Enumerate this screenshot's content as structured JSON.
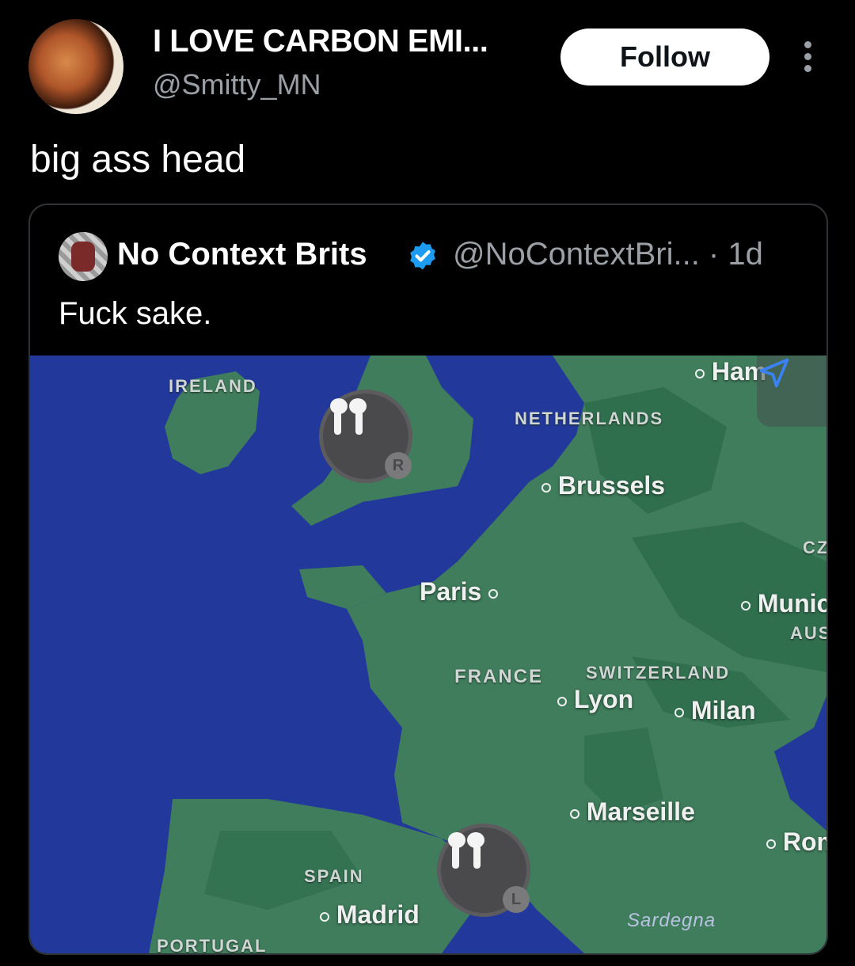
{
  "author": {
    "name": "I LOVE CARBON EMI...",
    "handle": "@Smitty_MN",
    "follow_label": "Follow"
  },
  "tweet_text": "big ass head",
  "quoted": {
    "name": "No Context Brits",
    "handle_time": "@NoContextBri... · 1d",
    "text": "Fuck sake."
  },
  "map": {
    "countries": {
      "ireland": "IRELAND",
      "netherlands": "NETHERLANDS",
      "france": "FRANCE",
      "switzerland": "SWITZERLAND",
      "spain": "SPAIN",
      "portugal": "PORTUGAL",
      "cz": "CZ",
      "aus": "AUS"
    },
    "cities": {
      "ham": "Ham",
      "brussels": "Brussels",
      "paris": "Paris",
      "munich": "Munic",
      "lyon": "Lyon",
      "milan": "Milan",
      "marseille": "Marseille",
      "rome": "Rom",
      "madrid": "Madrid"
    },
    "seas": {
      "sardegna": "Sardegna"
    },
    "pins": [
      {
        "device": "airpods-icon",
        "badge": "R"
      },
      {
        "device": "airpods-icon",
        "badge": "L"
      }
    ],
    "colors": {
      "sea": "#22389a",
      "land": "#3f7d5c",
      "land_dark": "#2c6b4a"
    }
  }
}
